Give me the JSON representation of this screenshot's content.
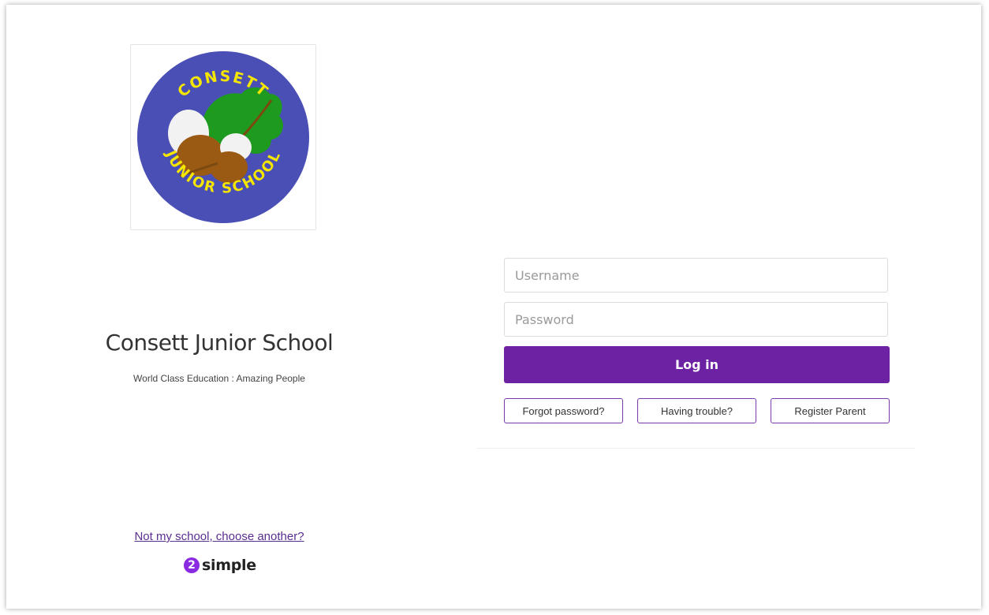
{
  "school": {
    "name": "Consett Junior School",
    "motto": "World Class Education : Amazing People",
    "logo": {
      "top_text": "CONSETT",
      "bottom_text": "JUNIOR SCHOOL",
      "colors": {
        "background": "#4a4fb5",
        "text": "#f5e600",
        "leaf": "#1e9a1e",
        "acorn_cup": "#9b5a14",
        "acorn_nut": "#f2f2f2"
      }
    }
  },
  "login": {
    "username_placeholder": "Username",
    "password_placeholder": "Password",
    "login_label": "Log in",
    "forgot_label": "Forgot password?",
    "trouble_label": "Having trouble?",
    "register_label": "Register Parent"
  },
  "footer": {
    "change_school_link": "Not my school, choose another?",
    "brand_badge": "2",
    "brand_name": "simple"
  },
  "colors": {
    "accent": "#6d22a3",
    "link": "#5a2d91"
  }
}
